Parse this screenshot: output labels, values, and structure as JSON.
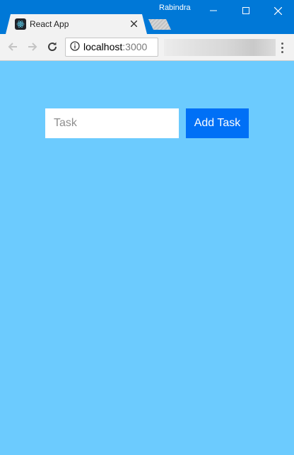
{
  "browser": {
    "profile_name": "Rabindra",
    "tab": {
      "title": "React App"
    },
    "address_bar": {
      "host": "localhost",
      "port": ":3000"
    }
  },
  "page": {
    "task_input": {
      "placeholder": "Task",
      "value": ""
    },
    "add_button_label": "Add Task",
    "background_color": "#6ccbfe",
    "button_color": "#0070f6"
  },
  "icons": {
    "favicon": "react-logo-icon",
    "tab_close": "close-icon",
    "back": "arrow-left-icon",
    "forward": "arrow-right-icon",
    "reload": "reload-icon",
    "site_info": "info-icon",
    "menu": "kebab-menu-icon",
    "window_minimize": "minimize-icon",
    "window_maximize": "maximize-icon",
    "window_close": "close-icon"
  }
}
